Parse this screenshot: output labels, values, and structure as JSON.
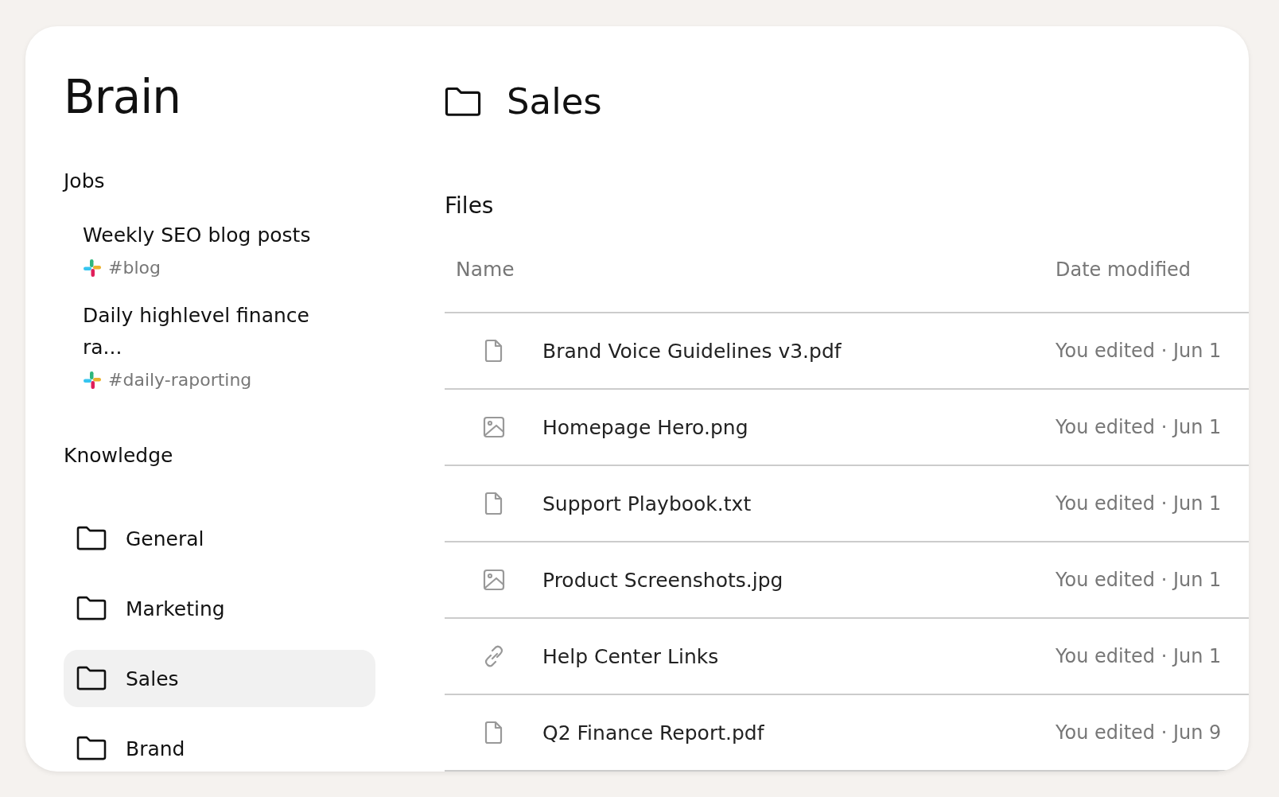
{
  "sidebar": {
    "title": "Brain",
    "jobs": {
      "heading": "Jobs",
      "items": [
        {
          "title": "Weekly SEO blog posts",
          "channel": "#blog"
        },
        {
          "title": "Daily highlevel finance ra...",
          "channel": "#daily-raporting"
        }
      ]
    },
    "knowledge": {
      "heading": "Knowledge",
      "items": [
        {
          "label": "General",
          "selected": false
        },
        {
          "label": "Marketing",
          "selected": false
        },
        {
          "label": "Sales",
          "selected": true
        },
        {
          "label": "Brand",
          "selected": false
        }
      ]
    }
  },
  "main": {
    "title": "Sales",
    "section": "Files",
    "table": {
      "columns": [
        "Name",
        "Date modified"
      ],
      "rows": [
        {
          "kind": "document",
          "name": "Brand Voice Guidelines v3.pdf",
          "modified": "You edited · Jun 1"
        },
        {
          "kind": "image",
          "name": "Homepage Hero.png",
          "modified": "You edited · Jun 1"
        },
        {
          "kind": "document",
          "name": "Support Playbook.txt",
          "modified": "You edited · Jun 1"
        },
        {
          "kind": "image",
          "name": "Product Screenshots.jpg",
          "modified": "You edited · Jun 1"
        },
        {
          "kind": "link",
          "name": "Help Center Links",
          "modified": "You edited · Jun 1"
        },
        {
          "kind": "document",
          "name": "Q2 Finance Report.pdf",
          "modified": "You edited · Jun 9"
        }
      ]
    }
  }
}
